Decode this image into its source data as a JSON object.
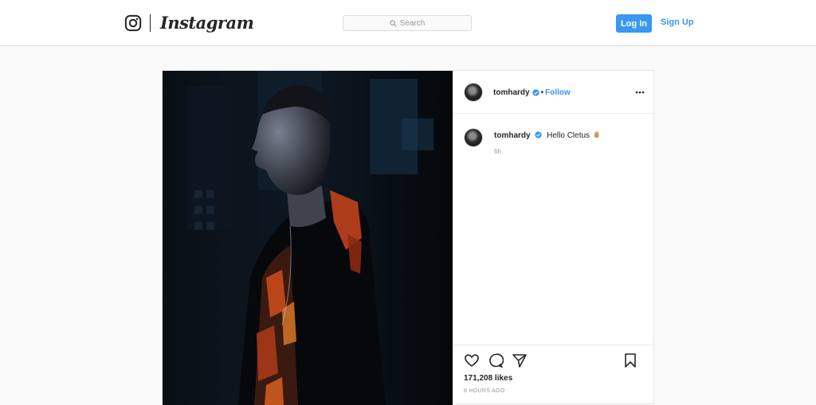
{
  "nav": {
    "brand_name": "Instagram",
    "search_placeholder": "Search",
    "login_label": "Log In",
    "signup_label": "Sign Up",
    "accent_color": "#3897f0"
  },
  "post": {
    "username": "tomhardy",
    "follow_label": "Follow",
    "separator": "•",
    "caption": "Hello Cletus",
    "caption_emoji": "hand-emoji",
    "comment_time": "6h",
    "likes": "171,208 likes",
    "time_ago": "8 HOURS AGO",
    "icons": [
      "heart-icon",
      "comment-icon",
      "share-icon",
      "bookmark-icon",
      "more-options-icon",
      "verified-badge-icon"
    ]
  }
}
